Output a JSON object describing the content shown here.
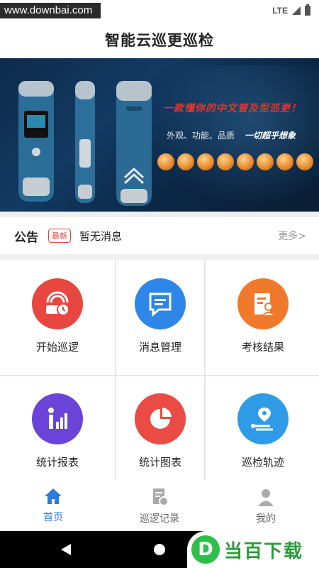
{
  "status_bar": {
    "watermark_url": "www.downbai.com",
    "network": "LTE"
  },
  "app": {
    "title": "智能云巡更巡检"
  },
  "banner": {
    "slogan": "一款懂你的中文普及型巡更！",
    "features": "外观、功能、品质",
    "tagline": "一切超乎想象"
  },
  "notice": {
    "title": "公告",
    "badge": "最新",
    "message": "暂无消息",
    "more": "更多>"
  },
  "grid": [
    {
      "label": "开始巡逻",
      "icon": "patrol-start-icon",
      "color": "#e8473f"
    },
    {
      "label": "消息管理",
      "icon": "message-icon",
      "color": "#2d86e8"
    },
    {
      "label": "考核结果",
      "icon": "assessment-icon",
      "color": "#f0792c"
    },
    {
      "label": "统计报表",
      "icon": "report-icon",
      "color": "#6a44d8"
    },
    {
      "label": "统计图表",
      "icon": "pie-chart-icon",
      "color": "#ea4b45"
    },
    {
      "label": "巡检轨迹",
      "icon": "track-icon",
      "color": "#2f9be6"
    }
  ],
  "tabs": [
    {
      "label": "首页",
      "icon": "home-icon",
      "active": true
    },
    {
      "label": "巡逻记录",
      "icon": "record-icon",
      "active": false
    },
    {
      "label": "我的",
      "icon": "profile-icon",
      "active": false
    }
  ],
  "watermark_logo": {
    "mark": "D",
    "text": "当百下载"
  },
  "colors": {
    "accent": "#2d7be2",
    "badge": "#e0493e"
  }
}
